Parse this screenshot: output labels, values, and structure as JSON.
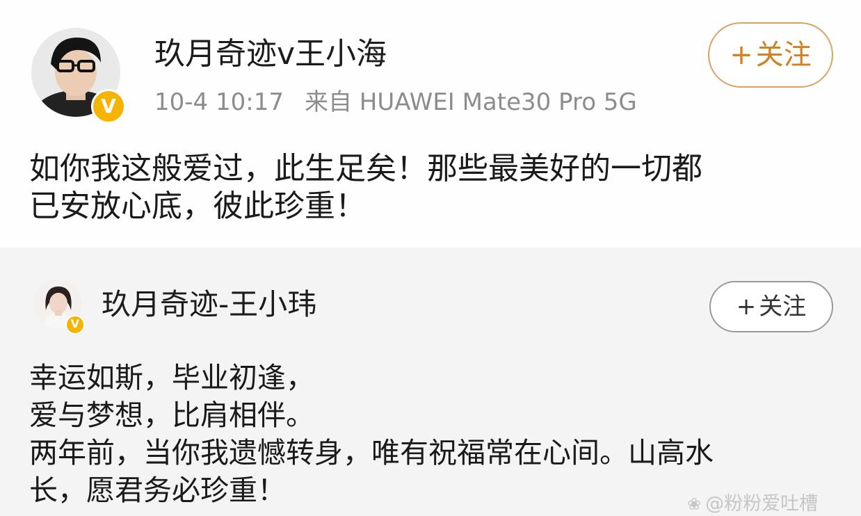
{
  "post1": {
    "username": "玖月奇迹v王小海",
    "verified_badge": "V",
    "follow_label": "关注",
    "timestamp": "10-4 10:17",
    "source": "来自 HUAWEI Mate30 Pro 5G",
    "text_lines": [
      "如你我这般爱过，此生足矣！那些最美好的一切都",
      "已安放心底，彼此珍重！"
    ],
    "accent_color": "#d08220"
  },
  "post2": {
    "username": "玖月奇迹-王小玮",
    "verified_badge": "V",
    "follow_label": "关注",
    "text_lines": [
      "幸运如斯，毕业初逢，",
      "爱与梦想，比肩相伴。",
      "两年前，当你我遗憾转身，唯有祝福常在心间。山高水",
      "长，愿君务必珍重！"
    ]
  },
  "watermark": "@粉粉爱吐槽",
  "icons": {
    "plus": "plus-icon",
    "verified": "verified-badge-icon",
    "watermark": "paw-icon"
  }
}
